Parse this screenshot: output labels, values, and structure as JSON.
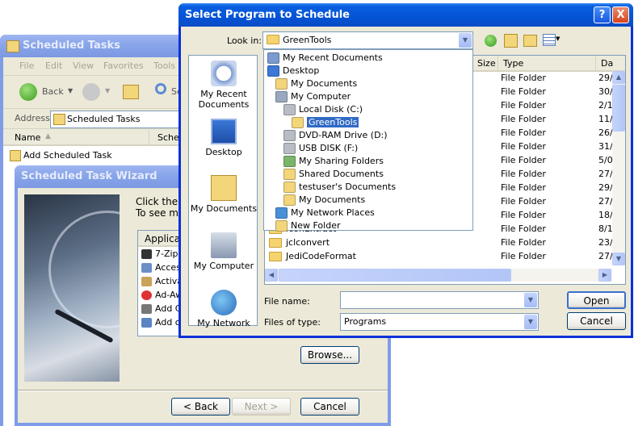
{
  "explorer": {
    "title": "Scheduled Tasks",
    "menu": [
      "File",
      "Edit",
      "View",
      "Favorites",
      "Tools"
    ],
    "back_label": "Back",
    "search_partial": "Se",
    "address_label": "Address",
    "address_value": "Scheduled Tasks",
    "col_name": "Name",
    "col_schedule_partial": "Sche",
    "task_item": "Add Scheduled Task"
  },
  "wizard": {
    "title": "Scheduled Task Wizard",
    "text_line1": "Click the pr",
    "text_line2": "To see mor",
    "list_header": "Applicatio",
    "apps": [
      "7-Zip",
      "Acces",
      "Activa",
      "Ad-Aw",
      "Add C",
      "Add o"
    ],
    "browse_label": "Browse...",
    "back_label": "< Back",
    "next_label": "Next >",
    "cancel_label": "Cancel"
  },
  "dialog": {
    "title": "Select Program to Schedule",
    "help": "?",
    "close": "X",
    "look_in_label": "Look in:",
    "look_in_value": "GreenTools",
    "places": [
      "My Recent Documents",
      "Desktop",
      "My Documents",
      "My Computer",
      "My Network"
    ],
    "dropdown_items": [
      {
        "label": "My Recent Documents",
        "indent": 0
      },
      {
        "label": "Desktop",
        "indent": 0
      },
      {
        "label": "My Documents",
        "indent": 1
      },
      {
        "label": "My Computer",
        "indent": 1
      },
      {
        "label": "Local Disk (C:)",
        "indent": 2
      },
      {
        "label": "GreenTools",
        "indent": 3,
        "selected": true
      },
      {
        "label": "DVD-RAM Drive (D:)",
        "indent": 2
      },
      {
        "label": "USB DISK (F:)",
        "indent": 2
      },
      {
        "label": "My Sharing Folders",
        "indent": 2
      },
      {
        "label": "Shared Documents",
        "indent": 2
      },
      {
        "label": "testuser's Documents",
        "indent": 2
      },
      {
        "label": "My Documents",
        "indent": 2
      },
      {
        "label": "My Network Places",
        "indent": 1
      },
      {
        "label": "New Folder",
        "indent": 1
      }
    ],
    "columns": {
      "size": "Size",
      "type": "Type",
      "date": "Da"
    },
    "file_rows": [
      {
        "name": "",
        "type": "File Folder",
        "date": "29/"
      },
      {
        "name": "",
        "type": "File Folder",
        "date": "30/"
      },
      {
        "name": "",
        "type": "File Folder",
        "date": "2/1"
      },
      {
        "name": "",
        "type": "File Folder",
        "date": "11/"
      },
      {
        "name": "",
        "type": "File Folder",
        "date": "26/"
      },
      {
        "name": "",
        "type": "File Folder",
        "date": "31/"
      },
      {
        "name": "",
        "type": "File Folder",
        "date": "5/0"
      },
      {
        "name": "",
        "type": "File Folder",
        "date": "27/"
      },
      {
        "name": "",
        "type": "File Folder",
        "date": "29/"
      },
      {
        "name": "",
        "type": "File Folder",
        "date": "27/"
      },
      {
        "name": "",
        "type": "File Folder",
        "date": "18/"
      },
      {
        "name": "IconExtract",
        "type": "File Folder",
        "date": "8/1"
      },
      {
        "name": "jclconvert",
        "type": "File Folder",
        "date": "23/"
      },
      {
        "name": "JediCodeFormat",
        "type": "File Folder",
        "date": "27/"
      }
    ],
    "file_name_label": "File name:",
    "file_name_value": "",
    "files_of_type_label": "Files of type:",
    "files_of_type_value": "Programs",
    "open_label": "Open",
    "cancel_label": "Cancel",
    "colors": {
      "title_active": "#0a5fe0",
      "selection": "#316ac5",
      "close_red": "#d8441c"
    }
  }
}
